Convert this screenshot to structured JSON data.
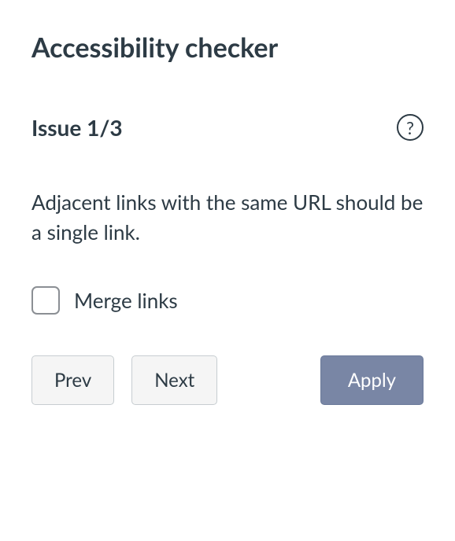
{
  "title": "Accessibility checker",
  "issue": {
    "current": 1,
    "total": 3,
    "label": "Issue 1/3"
  },
  "help": {
    "symbol": "?"
  },
  "description": "Adjacent links with the same URL should be a single link.",
  "checkbox": {
    "label": "Merge links",
    "checked": false
  },
  "buttons": {
    "prev": "Prev",
    "next": "Next",
    "apply": "Apply"
  }
}
